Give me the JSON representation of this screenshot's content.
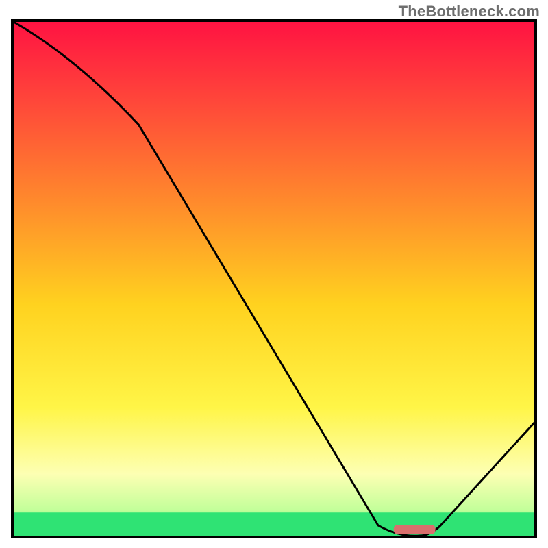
{
  "watermark": "TheBottleneck.com",
  "chart_data": {
    "type": "line",
    "title": "",
    "xlabel": "",
    "ylabel": "",
    "xlim": [
      0,
      100
    ],
    "ylim": [
      0,
      100
    ],
    "x": [
      0,
      24,
      70,
      78,
      82,
      100
    ],
    "values": [
      100,
      80,
      2,
      0,
      2,
      22
    ],
    "marker": {
      "x_start": 73,
      "x_end": 81,
      "y": 1.2
    },
    "gradient_stops": [
      {
        "pos": 0.0,
        "color": "#ff1342"
      },
      {
        "pos": 0.15,
        "color": "#ff453a"
      },
      {
        "pos": 0.35,
        "color": "#ff8a2c"
      },
      {
        "pos": 0.55,
        "color": "#ffd21f"
      },
      {
        "pos": 0.75,
        "color": "#fff547"
      },
      {
        "pos": 0.88,
        "color": "#fdffb3"
      },
      {
        "pos": 0.95,
        "color": "#c3ff9a"
      },
      {
        "pos": 1.0,
        "color": "#22e26e"
      }
    ],
    "green_band": {
      "y_from_bottom": 0,
      "height_pct": 4.5
    },
    "yellow_band": {
      "y_from_bottom": 4.5,
      "height_pct": 6.5
    }
  }
}
